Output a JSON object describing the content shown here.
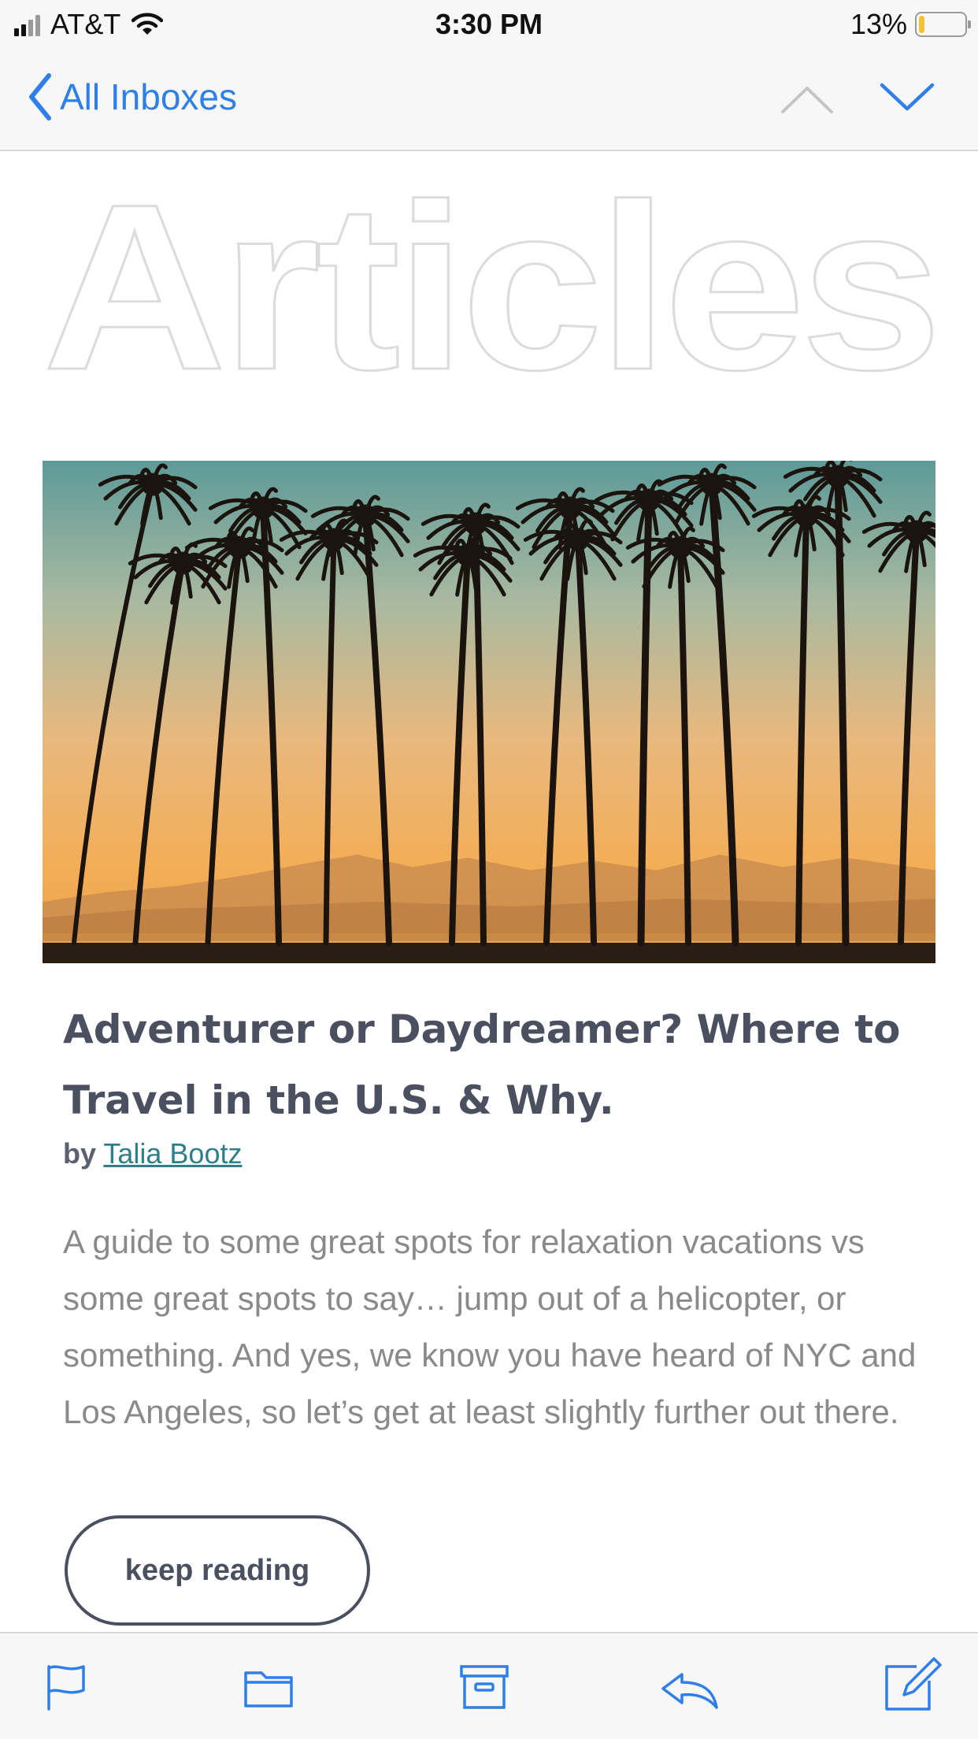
{
  "status_bar": {
    "carrier": "AT&T",
    "time": "3:30 PM",
    "battery_percent": "13%",
    "battery_level": 0.13,
    "icons": [
      "signal-icon",
      "wifi-icon",
      "battery-icon"
    ]
  },
  "nav": {
    "back_label": "All Inboxes",
    "icons": [
      "chevron-left-icon",
      "chevron-up-icon",
      "chevron-down-icon"
    ]
  },
  "email": {
    "header_title": "Articles",
    "photo_description_icon": "palm-trees-sunset-photo",
    "article_title": "Adventurer or Daydreamer? Where to Travel in the U.S. & Why.",
    "byline_prefix": "by",
    "author": "Talia Bootz",
    "excerpt": "A guide to some great spots for relaxation vacations vs some great spots to say… jump out of a helicopter, or something. And yes, we know you have heard of NYC and Los Angeles, so let’s get at least slightly further out there.",
    "cta_label": "keep reading"
  },
  "toolbar": {
    "icons": [
      "flag-icon",
      "folder-icon",
      "archive-icon",
      "reply-icon",
      "compose-icon"
    ]
  },
  "colors": {
    "ios_blue": "#2f7fe8",
    "title_gray": "#4b5060",
    "body_gray": "#8a8a8a",
    "link_teal": "#2e7f8a",
    "battery_yellow": "#f2c230"
  }
}
